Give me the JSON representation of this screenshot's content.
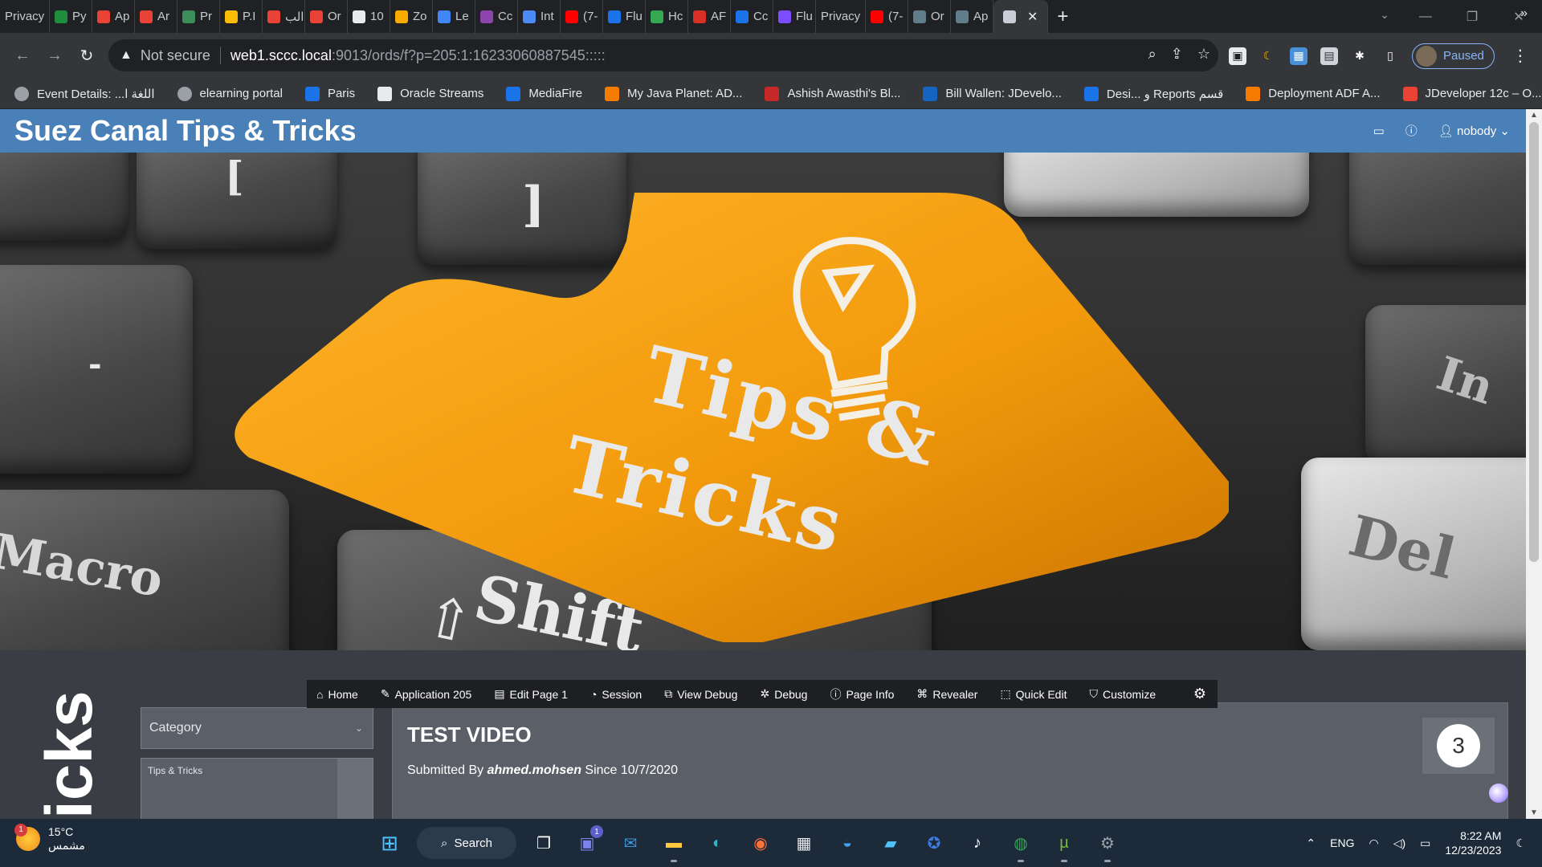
{
  "browser": {
    "tabs": [
      {
        "label": "Privacy",
        "color": "#5f6368"
      },
      {
        "label": "Py",
        "color": "#1e8e3e"
      },
      {
        "label": "Ap",
        "color": "#ea4335"
      },
      {
        "label": "Ar",
        "color": "#ea4335"
      },
      {
        "label": "Pr",
        "color": "#3c8d5a"
      },
      {
        "label": "P.I",
        "color": "#fbbc04"
      },
      {
        "label": "الب",
        "color": "#ea4335"
      },
      {
        "label": "Or",
        "color": "#ea4335"
      },
      {
        "label": "10",
        "color": "#e8eaed"
      },
      {
        "label": "Zo",
        "color": "#f9ab00"
      },
      {
        "label": "Le",
        "color": "#4285f4"
      },
      {
        "label": "Cc",
        "color": "#8e44ad"
      },
      {
        "label": "Int",
        "color": "#4c8bf5"
      },
      {
        "label": "(7-",
        "color": "#ff0000"
      },
      {
        "label": "Flu",
        "color": "#1a73e8"
      },
      {
        "label": "Hc",
        "color": "#34a853"
      },
      {
        "label": "AF",
        "color": "#d93025"
      },
      {
        "label": "Cc",
        "color": "#1a73e8"
      },
      {
        "label": "Flu",
        "color": "#7c4dff"
      },
      {
        "label": "Privacy",
        "color": "#5f6368"
      },
      {
        "label": "(7-",
        "color": "#ff0000"
      },
      {
        "label": "Or",
        "color": "#607d8b"
      },
      {
        "label": "Ap",
        "color": "#607d8b"
      }
    ],
    "active_tab_icon": "apex-icon",
    "new_tab_label": "+",
    "address": {
      "security_label": "Not secure",
      "host": "web1.sccc.local",
      "path": ":9013/ords/f?p=205:1:16233060887545:::::"
    },
    "profile_label": "Paused",
    "bookmarks": [
      {
        "label": "Event Details: ...اللغة ا",
        "color": "#9aa0a6"
      },
      {
        "label": "elearning portal",
        "color": "#9aa0a6"
      },
      {
        "label": "Paris",
        "color": "#1a73e8"
      },
      {
        "label": "Oracle Streams",
        "color": "#e8eaed"
      },
      {
        "label": "MediaFire",
        "color": "#1a73e8"
      },
      {
        "label": "My Java Planet: AD...",
        "color": "#f57c00"
      },
      {
        "label": "Ashish Awasthi's Bl...",
        "color": "#c62828"
      },
      {
        "label": "Bill Wallen: JDevelo...",
        "color": "#1565c0"
      },
      {
        "label": "Desi... و Reports قسم",
        "color": "#1a73e8"
      },
      {
        "label": "Deployment ADF A...",
        "color": "#f57c00"
      },
      {
        "label": "JDeveloper 12c – O...",
        "color": "#ea4335"
      }
    ],
    "bookmarks_more": "»"
  },
  "app": {
    "title": "Suez Canal Tips & Tricks",
    "user_label": "nobody",
    "hero": {
      "key_main_line1": "Tips &",
      "key_main_line2": "Tricks",
      "key_macro": "Macro",
      "key_shift": "Shift",
      "key_del": "Del",
      "key_ins": "In"
    },
    "vertical_text": "icks",
    "category_select": {
      "value": "Category"
    },
    "category_list": {
      "item": "Tips & Tricks"
    },
    "card": {
      "title": "TEST VIDEO",
      "meta_prefix": "Submitted By",
      "author": "ahmed.mohsen",
      "meta_since": "Since 10/7/2020",
      "count": "3"
    },
    "devbar": [
      {
        "label": "Home",
        "icon": "home-icon"
      },
      {
        "label": "Application 205",
        "icon": "edit-icon"
      },
      {
        "label": "Edit Page 1",
        "icon": "page-icon"
      },
      {
        "label": "Session",
        "icon": "session-icon"
      },
      {
        "label": "View Debug",
        "icon": "view-debug-icon"
      },
      {
        "label": "Debug",
        "icon": "bug-icon"
      },
      {
        "label": "Page Info",
        "icon": "info-icon"
      },
      {
        "label": "Revealer",
        "icon": "revealer-icon"
      },
      {
        "label": "Quick Edit",
        "icon": "quick-edit-icon"
      },
      {
        "label": "Customize",
        "icon": "customize-icon"
      }
    ]
  },
  "taskbar": {
    "weather_temp": "15°C",
    "weather_desc": "مشمس",
    "weather_badge": "1",
    "search_label": "Search",
    "chat_badge": "1",
    "language": "ENG",
    "time": "8:22 AM",
    "date": "12/23/2023"
  }
}
